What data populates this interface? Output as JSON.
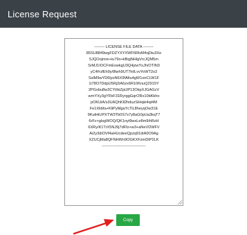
{
  "header": {
    "title": "License Request"
  },
  "license": {
    "lines": [
      "-------- LICENSE FILE DATA --------",
      "85SU8849wgFDZYXYXWF6RlvM4qDiu3Xe",
      "5JQOojmre+iu79o+kBqjNHlgVrcJQM5m",
      "SrMJ1IOCFmExwkgU3Q4jzwYsJh/OTIN3",
      "yC4FufEh9y/8lwh9UT7hiILvvYoWT2o2",
      "SslM9wYD6lyoN6X9fAfiu4gW1onCLW1F",
      "1i78O7DdpU5Rj2iA6zx6R10KnuQ2915Y",
      "2PGxbu8w3CYt/biZptJP13OkpXJGAGcV",
      "wrnYXy3gYFbF31RyrggGqrORx10bKkho",
      "pOKUiA/s3UAQhKll2hduzSiHqki4qt4M",
      "Fe1Xkbfa+KliPyMgaYcTiL8heyqOw31E",
      "9KutHiUPXTW3Tb0S7s7y8aG0pUa3kqT7",
      "6rFv+glsgWOQ/QK1nyt9wxLe8m9ihRzH",
      "6XRy/K1TrX5NJ9j7dFfz+w3+aNeVDWFV",
      "Ai2y3diOVf4aHUcdeeQpzq91diA0O9Ag",
      "XZUCjMa8QFNHWn9OGKXFzmDtP2LK",
      "----------------------------------"
    ]
  },
  "actions": {
    "copy_label": "Copy"
  },
  "colors": {
    "header_bg": "#3a4147",
    "copy_bg": "#28a745",
    "arrow": "#e0201f"
  }
}
